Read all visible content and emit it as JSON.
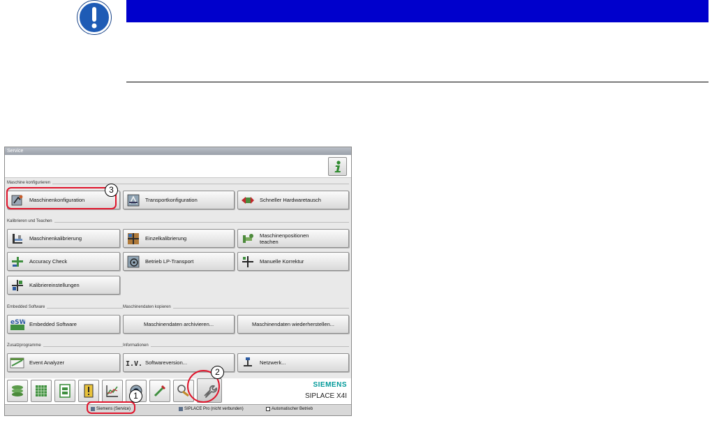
{
  "window": {
    "title": "Service"
  },
  "sections": {
    "maschine_konfigurieren": "Maschine konfigurieren",
    "kalibrieren_teachen": "Kalibrieren und Teachen",
    "embedded_software": "Embedded Software",
    "maschinendaten_kopieren": "Maschinendaten kopieren",
    "zusatzprogramme": "Zusatzprogramme",
    "informationen": "Informationen"
  },
  "buttons": {
    "maschinenkonfiguration": "Maschinenkonfiguration",
    "transportkonfiguration": "Transportkonfiguration",
    "schneller_hardwaretausch": "Schneller Hardwaretausch",
    "maschinenkalibrierung": "Maschinenkalibrierung",
    "einzelkalibrierung": "Einzelkalibrierung",
    "maschinenpositionen_teachen": "Maschinenpositionen teachen",
    "accuracy_check": "Accuracy Check",
    "betrieb_lp_transport": "Betrieb LP-Transport",
    "manuelle_korrektur": "Manuelle Korrektur",
    "kalibriereinstellungen": "Kalibriereinstellungen",
    "embedded_software": "Embedded Software",
    "maschinendaten_archivieren": "Maschinendaten archivieren...",
    "maschinendaten_wiederherstellen": "Maschinendaten wiederherstellen...",
    "event_analyzer": "Event Analyzer",
    "softwareversion": "Softwareversion...",
    "netzwerk": "Netzwerk..."
  },
  "branding": {
    "brand": "SIEMENS",
    "model": "SIPLACE X4I"
  },
  "status": {
    "user": "Siemens (Service)",
    "siplace_pro": "SIPLACE Pro (nicht verbunden)",
    "mode": "Automatischer Betrieb"
  },
  "callouts": [
    "1",
    "2",
    "3"
  ],
  "colors": {
    "notice_bar": "#0000cc",
    "callout": "#e0142b",
    "brand": "#009999"
  }
}
